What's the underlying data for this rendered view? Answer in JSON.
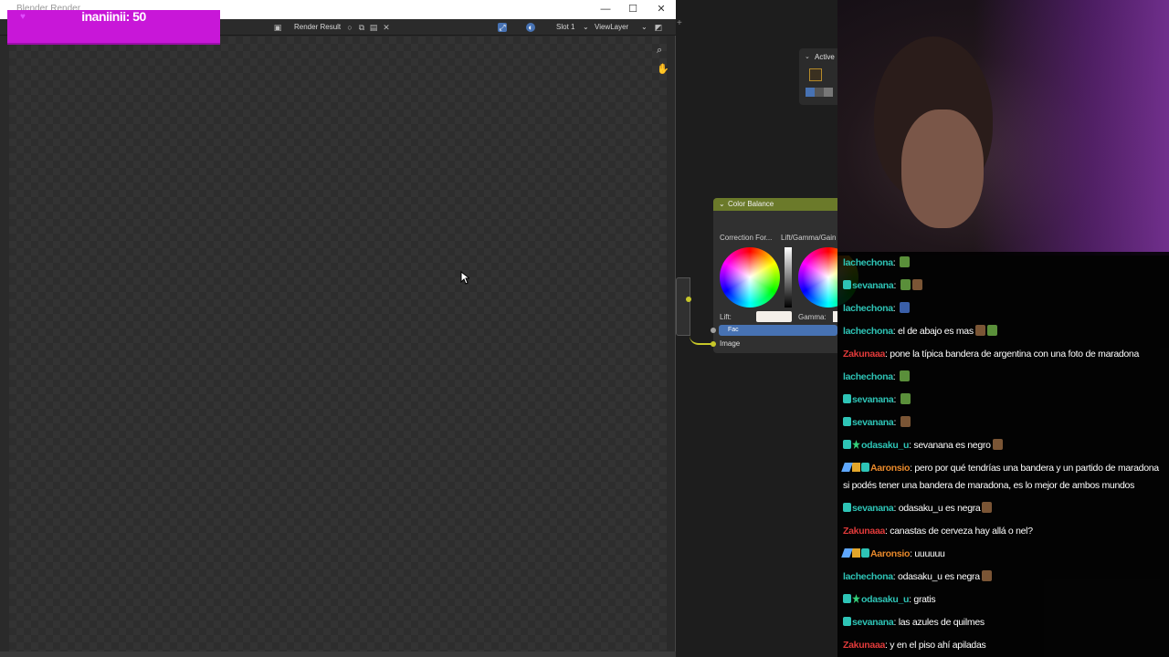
{
  "render_window": {
    "title": "Blender Render",
    "controls": {
      "minimize": "—",
      "maximize": "☐",
      "close": "✕"
    },
    "header": {
      "image_name": "Render Result",
      "slot": "Slot 1",
      "view_layer": "ViewLayer"
    }
  },
  "counter_overlay": {
    "text": "inaniinii: 50"
  },
  "node_editor": {
    "active_panel_label": "Active",
    "node": {
      "title": "Color Balance",
      "correction_label": "Correction For...",
      "mode_label": "Lift/Gamma/Gain",
      "lift_label": "Lift:",
      "gamma_label": "Gamma:",
      "fac_label": "Fac",
      "image_label": "Image"
    }
  },
  "chat": {
    "messages": [
      {
        "user": "lachechona",
        "color": "#2ec4b6",
        "badges": [],
        "text": "",
        "emotes": [
          "green"
        ]
      },
      {
        "user": "sevanana",
        "color": "#2ec4b6",
        "badges": [
          "sub"
        ],
        "text": "",
        "emotes": [
          "green",
          "brown"
        ]
      },
      {
        "user": "lachechona",
        "color": "#2ec4b6",
        "badges": [],
        "text": "",
        "emotes": [
          "blue"
        ]
      },
      {
        "user": "lachechona",
        "color": "#2ec4b6",
        "badges": [],
        "text": "el de abajo es mas",
        "emotes": [
          "brown",
          "green"
        ]
      },
      {
        "user": "Zakunaaa",
        "color": "#e03a3a",
        "badges": [],
        "text": "pone la típica bandera de argentina con una foto de maradona",
        "emotes": []
      },
      {
        "user": "lachechona",
        "color": "#2ec4b6",
        "badges": [],
        "text": "",
        "emotes": [
          "green"
        ]
      },
      {
        "user": "sevanana",
        "color": "#2ec4b6",
        "badges": [
          "sub"
        ],
        "text": "",
        "emotes": [
          "green"
        ]
      },
      {
        "user": "sevanana",
        "color": "#2ec4b6",
        "badges": [
          "sub"
        ],
        "text": "",
        "emotes": [
          "brown"
        ]
      },
      {
        "user": "odasaku_u",
        "color": "#2ec4b6",
        "badges": [
          "sub",
          "star"
        ],
        "text": "sevanana es negro",
        "emotes": [
          "brown"
        ]
      },
      {
        "user": "Aaronsio",
        "color": "#e8892b",
        "badges": [
          "sword",
          "crown",
          "sub"
        ],
        "text": "pero por qué tendrías una bandera y un partido de maradona si podés tener una bandera de maradona, es lo mejor de ambos mundos",
        "emotes": []
      },
      {
        "user": "sevanana",
        "color": "#2ec4b6",
        "badges": [
          "sub"
        ],
        "text": "odasaku_u es negra",
        "emotes": [
          "brown"
        ]
      },
      {
        "user": "Zakunaaa",
        "color": "#e03a3a",
        "badges": [],
        "text": "canastas de cerveza hay allá o nel?",
        "emotes": []
      },
      {
        "user": "Aaronsio",
        "color": "#e8892b",
        "badges": [
          "sword",
          "crown",
          "sub"
        ],
        "text": "uuuuuu",
        "emotes": []
      },
      {
        "user": "lachechona",
        "color": "#2ec4b6",
        "badges": [],
        "text": "odasaku_u es negra",
        "emotes": [
          "brown"
        ]
      },
      {
        "user": "odasaku_u",
        "color": "#2ec4b6",
        "badges": [
          "sub",
          "star"
        ],
        "text": "gratis",
        "emotes": []
      },
      {
        "user": "sevanana",
        "color": "#2ec4b6",
        "badges": [
          "sub"
        ],
        "text": "las azules de quilmes",
        "emotes": []
      },
      {
        "user": "Zakunaaa",
        "color": "#e03a3a",
        "badges": [],
        "text": "y en el piso ahí apiladas",
        "emotes": []
      }
    ]
  }
}
